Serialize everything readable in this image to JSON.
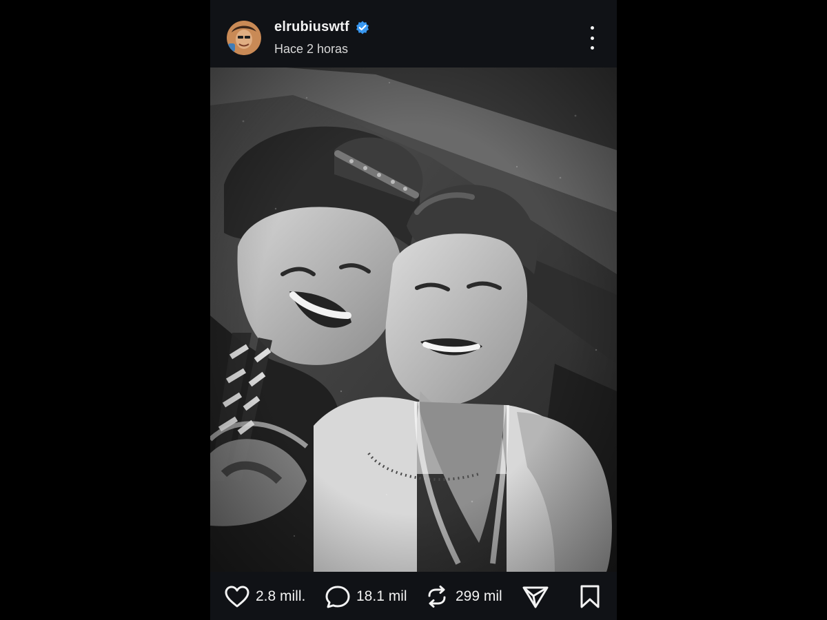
{
  "post": {
    "username": "elrubiuswtf",
    "timestamp": "Hace 2 horas",
    "verified": true,
    "avatar_icon": "user-avatar",
    "menu_icon": "more-vertical-icon"
  },
  "photo": {
    "description_icon": "black-and-white-selfie-photo"
  },
  "actions": {
    "likes": "2.8 mill.",
    "comments": "18.1 mil",
    "reposts": "299 mil",
    "like_icon": "heart-icon",
    "comment_icon": "comment-bubble-icon",
    "repost_icon": "repost-icon",
    "share_icon": "send-icon",
    "save_icon": "bookmark-icon"
  },
  "colors": {
    "background": "#000000",
    "panel": "#101216",
    "text": "#f3f3f3",
    "verified": "#3897f0"
  }
}
